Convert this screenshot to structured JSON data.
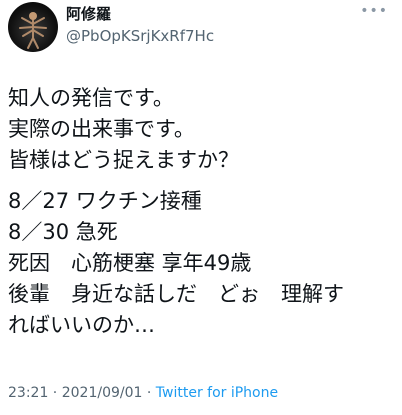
{
  "user": {
    "display_name": "阿修羅",
    "handle": "@PbOpKSrjKxRf7Hc"
  },
  "more_icon": "more-dots-icon",
  "tweet": {
    "paragraph1": [
      "知人の発信です。",
      "実際の出来事です。",
      "皆様はどう捉えますか？"
    ],
    "paragraph2": [
      "8／27 ワクチン接種",
      "8／30 急死",
      "死因　心筋梗塞 享年49歳",
      "後輩　身近な話しだ　どぉ　理解す",
      "ればいいのか…"
    ]
  },
  "meta": {
    "time": "23:21",
    "separator1": " · ",
    "date": "2021/09/01",
    "separator2": " · ",
    "source": "Twitter for iPhone"
  },
  "colors": {
    "text": "#0f1419",
    "secondary": "#536471",
    "link": "#1d9bf0"
  }
}
